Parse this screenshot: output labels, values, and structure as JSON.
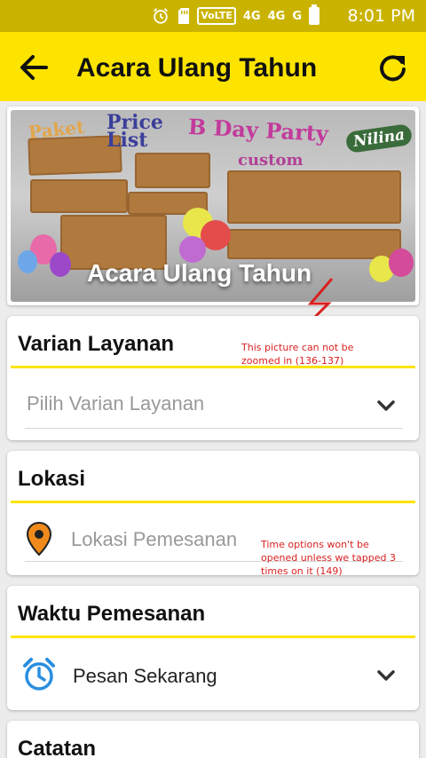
{
  "status_bar": {
    "time": "8:01 PM",
    "icons": [
      "alarm-icon",
      "sd-card-icon",
      "volte-icon",
      "4g-signal-icon",
      "4g-signal-icon",
      "g-no-signal-icon",
      "battery-icon"
    ],
    "volte": "VoLTE",
    "net1": "4G",
    "net2": "4G",
    "net3": "G"
  },
  "app_bar": {
    "title": "Acara Ulang Tahun",
    "back_icon": "arrow-left-icon",
    "refresh_icon": "refresh-icon"
  },
  "banner": {
    "caption": "Acara Ulang Tahun",
    "image_text": {
      "paket": "Paket",
      "price_list": "Price List",
      "bday": "B Day Party",
      "custom": "custom",
      "brand": "Nilina"
    }
  },
  "sections": {
    "varian": {
      "label": "Varian Layanan",
      "placeholder": "Pilih Varian Layanan"
    },
    "lokasi": {
      "label": "Lokasi",
      "placeholder": "Lokasi Pemesanan",
      "icon": "location-pin-icon"
    },
    "waktu": {
      "label": "Waktu Pemesanan",
      "value": "Pesan Sekarang",
      "icon": "alarm-clock-icon"
    },
    "catatan": {
      "label": "Catatan"
    }
  },
  "annotations": {
    "zoom_note": "This picture can not be zoomed in (136-137)",
    "time_note": "Time options won't be opened unless we tapped 3 times on it (149)"
  },
  "colors": {
    "accent_yellow": "#fde400",
    "status_bar": "#cab300",
    "pin": "#f08a1c",
    "clock": "#2a8fe0",
    "annotation_red": "#d92020"
  }
}
